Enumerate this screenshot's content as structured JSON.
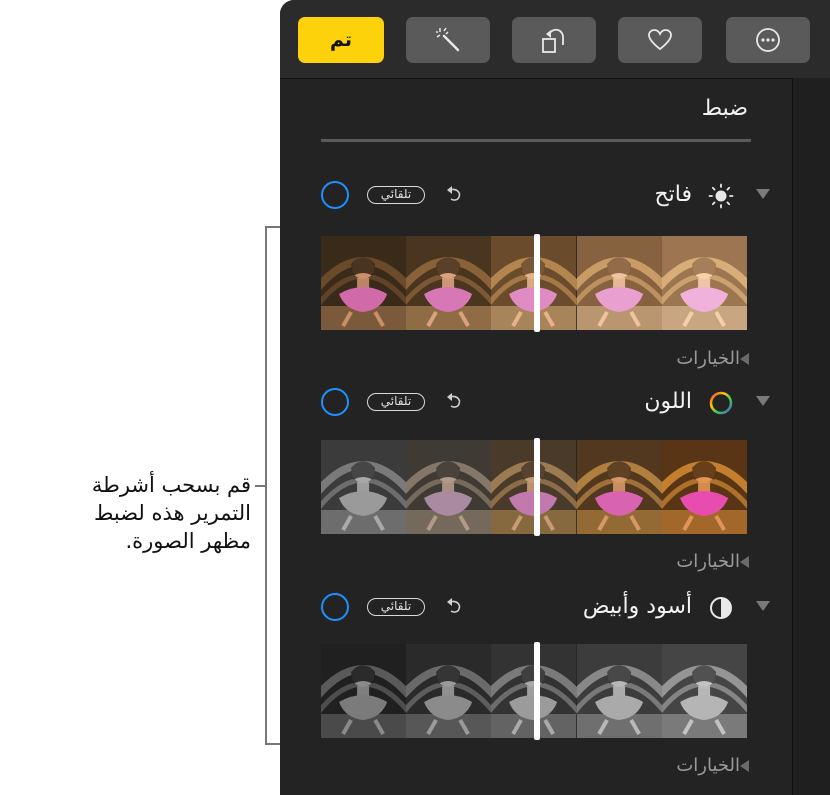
{
  "toolbar": {
    "done_label": "تم",
    "buttons": [
      {
        "name": "auto-enhance",
        "icon": "magic-wand-icon"
      },
      {
        "name": "rotate",
        "icon": "rotate-icon"
      },
      {
        "name": "favorite",
        "icon": "heart-icon"
      },
      {
        "name": "more",
        "icon": "ellipsis-circle-icon"
      }
    ],
    "accent_color": "#fdd20a"
  },
  "panel": {
    "title": "ضبط",
    "sections": [
      {
        "label": "فاتح",
        "icon": "sun-icon",
        "auto_label": "تلقائي",
        "options_label": "الخيارات",
        "style": "light"
      },
      {
        "label": "اللون",
        "icon": "color-wheel-icon",
        "auto_label": "تلقائي",
        "options_label": "الخيارات",
        "style": "color"
      },
      {
        "label": "أسود وأبيض",
        "icon": "half-circle-icon",
        "auto_label": "تلقائي",
        "options_label": "الخيارات",
        "style": "bw"
      }
    ],
    "toggle_color": "#1e90ff"
  },
  "callout": {
    "text": "قم بسحب أشرطة التمرير هذه لضبط مظهر الصورة."
  }
}
